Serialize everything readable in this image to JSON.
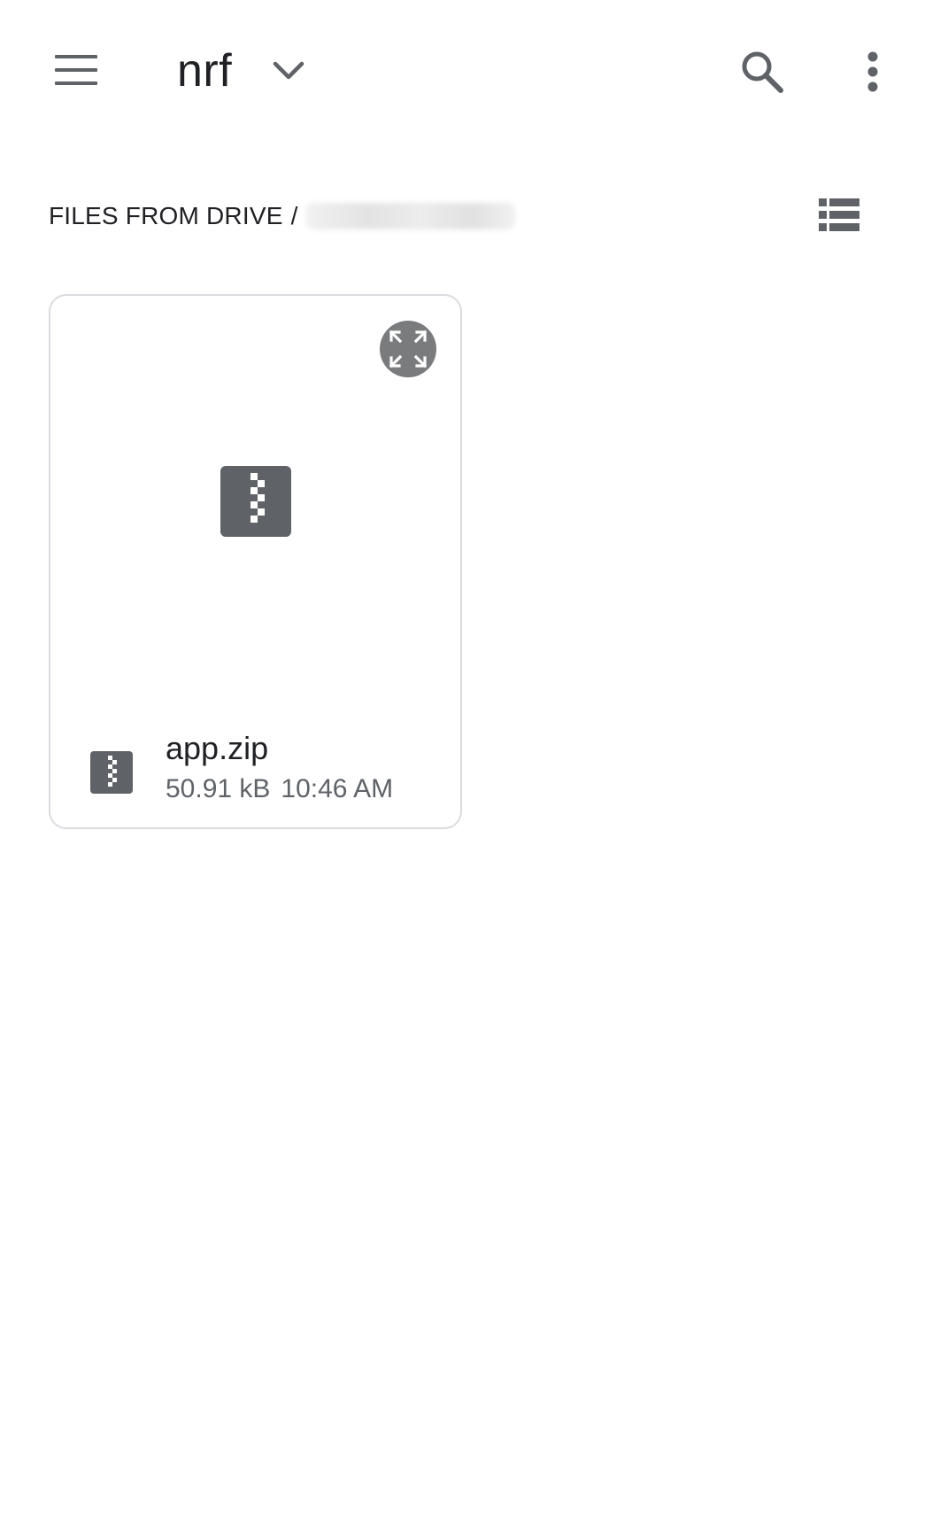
{
  "appbar": {
    "menu_icon": "hamburger-menu-icon",
    "title": "nrf",
    "dropdown_icon": "chevron-down-icon",
    "search_icon": "search-icon",
    "more_icon": "more-vert-icon"
  },
  "breadcrumb": {
    "root": "FILES FROM DRIVE",
    "separator": "/",
    "account_blurred": true
  },
  "view_toggle_icon": "list-view-icon",
  "files": [
    {
      "name": "app.zip",
      "size": "50.91 kB",
      "time": "10:46 AM",
      "type_icon": "zip-file-icon",
      "preview_icon": "zip-file-icon",
      "expand_icon": "fullscreen-expand-icon"
    }
  ],
  "colors": {
    "icon_gray": "#5f6368",
    "text_primary": "#202124",
    "text_secondary": "#5f6368",
    "card_border": "#dadce0",
    "expand_bg": "#7a7b7d"
  }
}
